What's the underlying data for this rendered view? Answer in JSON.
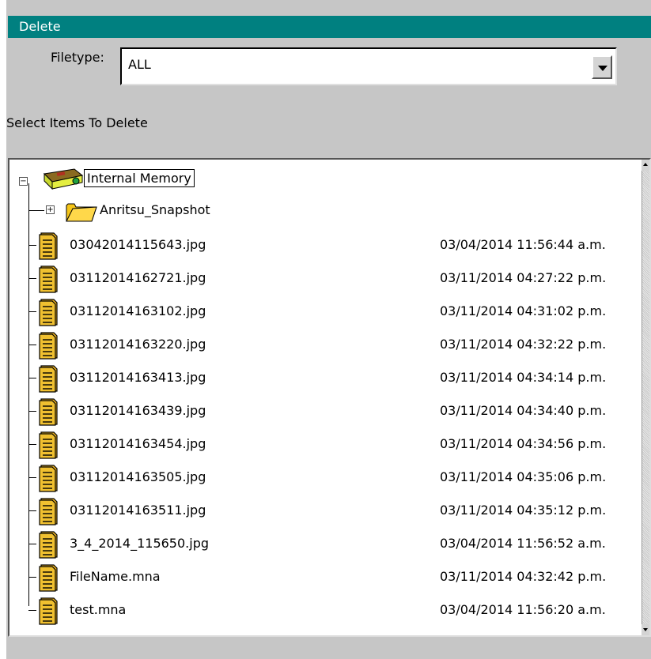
{
  "dialog": {
    "title": "Delete",
    "filetype_label": "Filetype:",
    "filetype_value": "ALL",
    "select_label": "Select Items To Delete"
  },
  "tree": {
    "root_label": "Internal Memory",
    "folder": {
      "name": "Anritsu_Snapshot"
    },
    "files": [
      {
        "name": "03042014115643.jpg",
        "date": "03/04/2014 11:56:44 a.m."
      },
      {
        "name": "03112014162721.jpg",
        "date": "03/11/2014 04:27:22 p.m."
      },
      {
        "name": "03112014163102.jpg",
        "date": "03/11/2014 04:31:02 p.m."
      },
      {
        "name": "03112014163220.jpg",
        "date": "03/11/2014 04:32:22 p.m."
      },
      {
        "name": "03112014163413.jpg",
        "date": "03/11/2014 04:34:14 p.m."
      },
      {
        "name": "03112014163439.jpg",
        "date": "03/11/2014 04:34:40 p.m."
      },
      {
        "name": "03112014163454.jpg",
        "date": "03/11/2014 04:34:56 p.m."
      },
      {
        "name": "03112014163505.jpg",
        "date": "03/11/2014 04:35:06 p.m."
      },
      {
        "name": "03112014163511.jpg",
        "date": "03/11/2014 04:35:12 p.m."
      },
      {
        "name": "3_4_2014_115650.jpg",
        "date": "03/04/2014 11:56:52 a.m."
      },
      {
        "name": "FileName.mna",
        "date": "03/11/2014 04:32:42 p.m."
      },
      {
        "name": "test.mna",
        "date": "03/04/2014 11:56:20 a.m."
      }
    ]
  },
  "colors": {
    "titlebar": "#008080",
    "dialog_bg": "#c6c6c6",
    "file_icon": "#e8b020",
    "folder_icon": "#f5c518"
  },
  "icons": {
    "root": "memory-drive-icon",
    "folder": "folder-icon",
    "file": "file-document-icon"
  }
}
